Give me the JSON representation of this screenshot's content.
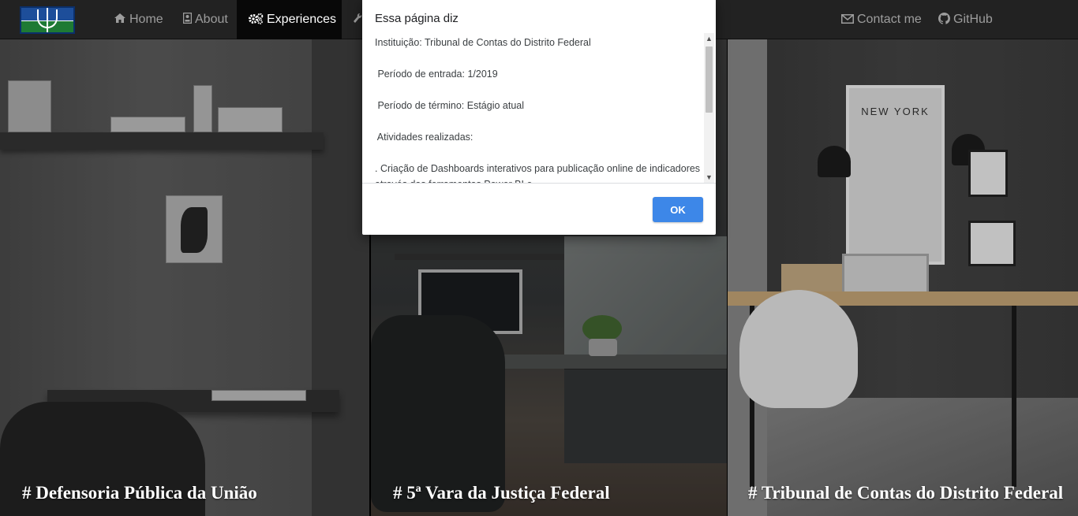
{
  "navbar": {
    "items": [
      {
        "label": "Home",
        "icon": "home-icon",
        "active": false
      },
      {
        "label": "About",
        "icon": "id-card-icon",
        "active": false
      },
      {
        "label": "Experiences",
        "icon": "gears-icon",
        "active": true
      },
      {
        "label": "Contact me",
        "icon": "envelope-icon",
        "active": false
      },
      {
        "label": "GitHub",
        "icon": "github-icon",
        "active": false
      }
    ],
    "active_background": "#080808",
    "background": "#222222"
  },
  "panels": [
    {
      "title": "# Defensoria Pública da União"
    },
    {
      "title": "# 5ª Vara da Justiça Federal"
    },
    {
      "title": "# Tribunal de Contas do Distrito Federal"
    }
  ],
  "dialog": {
    "title": "Essa página diz",
    "lines": [
      "Instituição: Tribunal de Contas do Distrito Federal",
      " Período de entrada: 1/2019",
      " Período de término: Estágio atual",
      " Atividades realizadas:",
      " . Criação de Dashboards interativos para publicação online de indicadores através das ferramentas Power BI e"
    ],
    "ok_label": "OK",
    "ok_color": "#3d87e8"
  },
  "posters": {
    "new_york": "NEW YORK"
  }
}
